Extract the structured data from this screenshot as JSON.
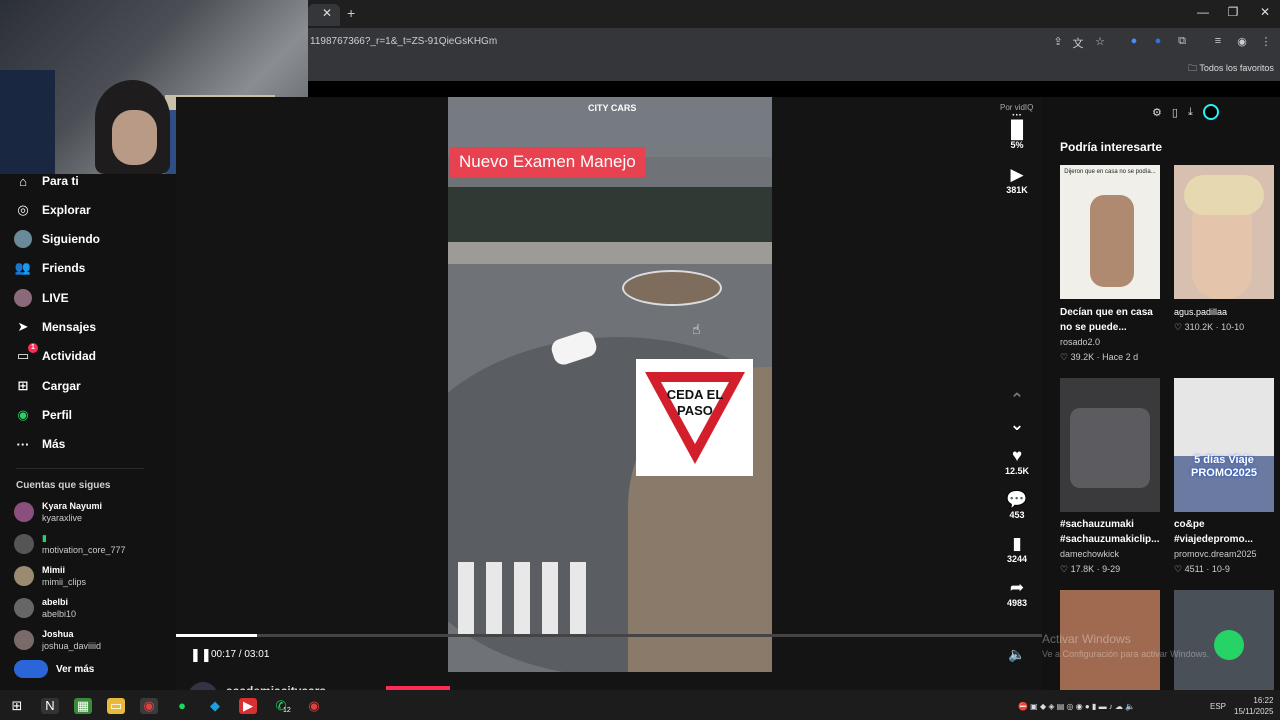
{
  "browser": {
    "url": "1198767366?_r=1&_t=ZS-91QieGsKHGm",
    "bookmarks_label": "Todos los favoritos",
    "window_controls": [
      "—",
      "❐",
      "✕"
    ]
  },
  "nav": {
    "items": [
      {
        "label": "Para ti",
        "icon": "home-icon"
      },
      {
        "label": "Explorar",
        "icon": "compass-icon"
      },
      {
        "label": "Siguiendo",
        "icon": "avatar"
      },
      {
        "label": "Friends",
        "icon": "people-icon"
      },
      {
        "label": "LIVE",
        "icon": "avatar"
      },
      {
        "label": "Mensajes",
        "icon": "send-icon"
      },
      {
        "label": "Actividad",
        "icon": "message-icon",
        "badge": "1"
      },
      {
        "label": "Cargar",
        "icon": "upload-icon"
      },
      {
        "label": "Perfil",
        "icon": "profile-icon"
      },
      {
        "label": "Más",
        "icon": "more-icon"
      }
    ],
    "following_title": "Cuentas que sigues",
    "following": [
      {
        "name": "Kyara Nayumi",
        "handle": "kyaraxlive"
      },
      {
        "name": "",
        "handle": "motivation_core_777"
      },
      {
        "name": "Mimii",
        "handle": "mimii_clips"
      },
      {
        "name": "abelbi",
        "handle": "abelbi10"
      },
      {
        "name": "Joshua",
        "handle": "joshua_daviiiid"
      }
    ],
    "see_more": "Ver más"
  },
  "video": {
    "title_overlay": "Nuevo Examen Manejo",
    "logo_text": "CITY CARS",
    "sign_text_1": "CEDA EL",
    "sign_text_2": "PASO",
    "time": "00:17 / 03:01",
    "progress": 0.094,
    "author": "academiacitycars"
  },
  "actions": {
    "poll_label": "Por vidIQ",
    "poll_value": "5%",
    "views": "381K",
    "likes": "12.5K",
    "comments": "453",
    "saves": "3244",
    "shares": "4983"
  },
  "recommendations": {
    "title": "Podría interesarte",
    "cards": [
      {
        "caption": "Decían que en casa no se puede...",
        "user": "rosado2.0",
        "stats": "♡ 39.2K · Hace 2 d",
        "thumb_text": "Dijeron que en casa no se podía..."
      },
      {
        "caption": "",
        "user": "agus.padillaa",
        "stats": "♡ 310.2K · 10-10",
        "thumb_text": ""
      },
      {
        "caption": "#sachauzumaki #sachauzumakiclip...",
        "user": "damechowkick",
        "stats": "♡ 17.8K · 9-29",
        "thumb_text": ""
      },
      {
        "caption": "co&pe #viajedepromo...",
        "user": "promovc.dream2025",
        "stats": "♡ 4511 · 10-9",
        "thumb_text": "5 días Viaje PROMO2025"
      }
    ]
  },
  "watermark": {
    "line1": "Activar Windows",
    "line2": "Ve a Configuración para activar Windows."
  },
  "taskbar": {
    "lang": "ESP",
    "time": "16:22",
    "date": "15/11/2025",
    "whatsapp_badge": "12"
  }
}
